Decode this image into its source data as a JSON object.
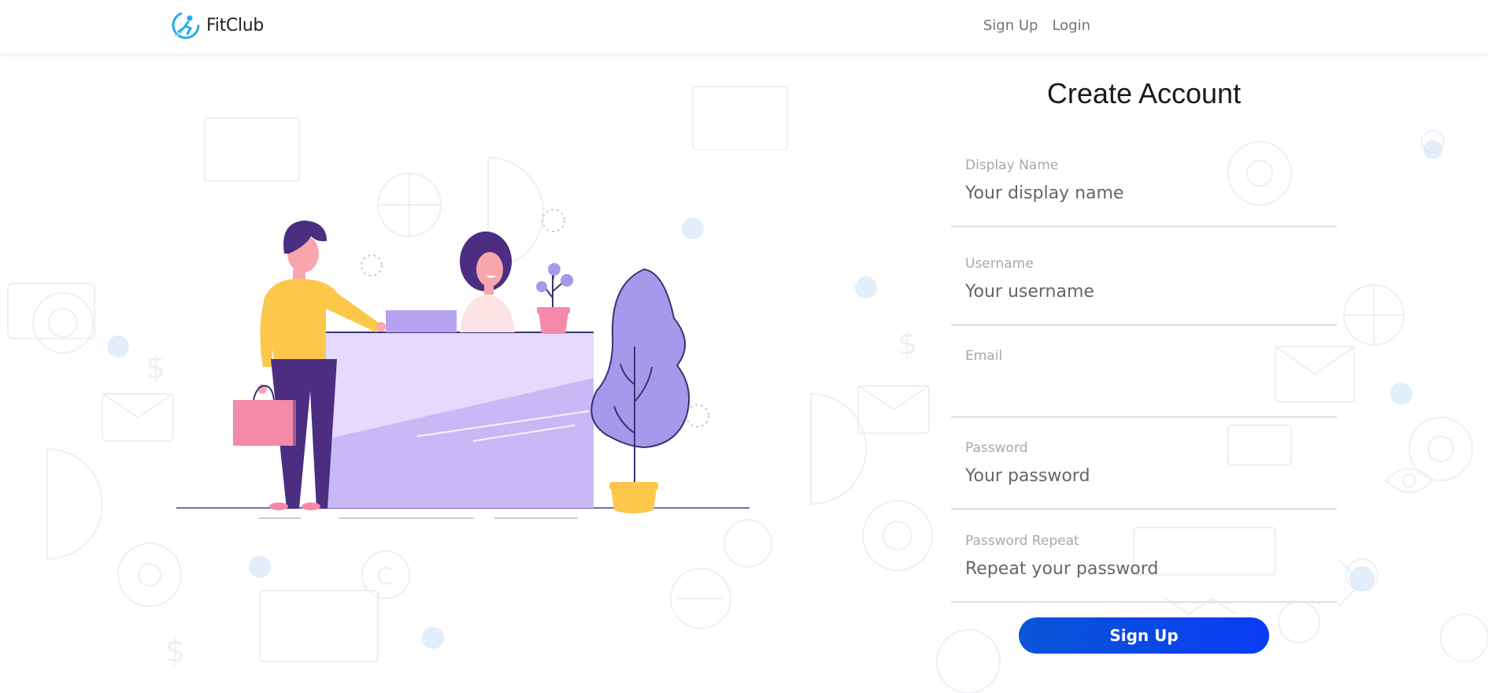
{
  "navbar": {
    "brand_name": "FitClub",
    "links": {
      "signup": "Sign Up",
      "login": "Login"
    }
  },
  "form": {
    "title": "Create Account",
    "fields": {
      "display_name": {
        "label": "Display Name",
        "placeholder": "Your display name",
        "value": ""
      },
      "username": {
        "label": "Username",
        "placeholder": "Your username",
        "value": ""
      },
      "email": {
        "label": "Email",
        "placeholder": "",
        "value": ""
      },
      "password": {
        "label": "Password",
        "placeholder": "Your password",
        "value": ""
      },
      "password_repeat": {
        "label": "Password Repeat",
        "placeholder": "Repeat your password",
        "value": ""
      }
    },
    "submit_label": "Sign Up"
  },
  "colors": {
    "brand_icon": "#2ba8e8",
    "button_gradient_start": "#0a55d6",
    "button_gradient_end": "#0a3cf5",
    "illustration_purple": "#a698ea",
    "illustration_yellow": "#fcc74b",
    "illustration_pink": "#f58aa8"
  },
  "icons": {
    "brand": "runner-in-circle-icon",
    "background": "faint-line-icon-pattern"
  }
}
